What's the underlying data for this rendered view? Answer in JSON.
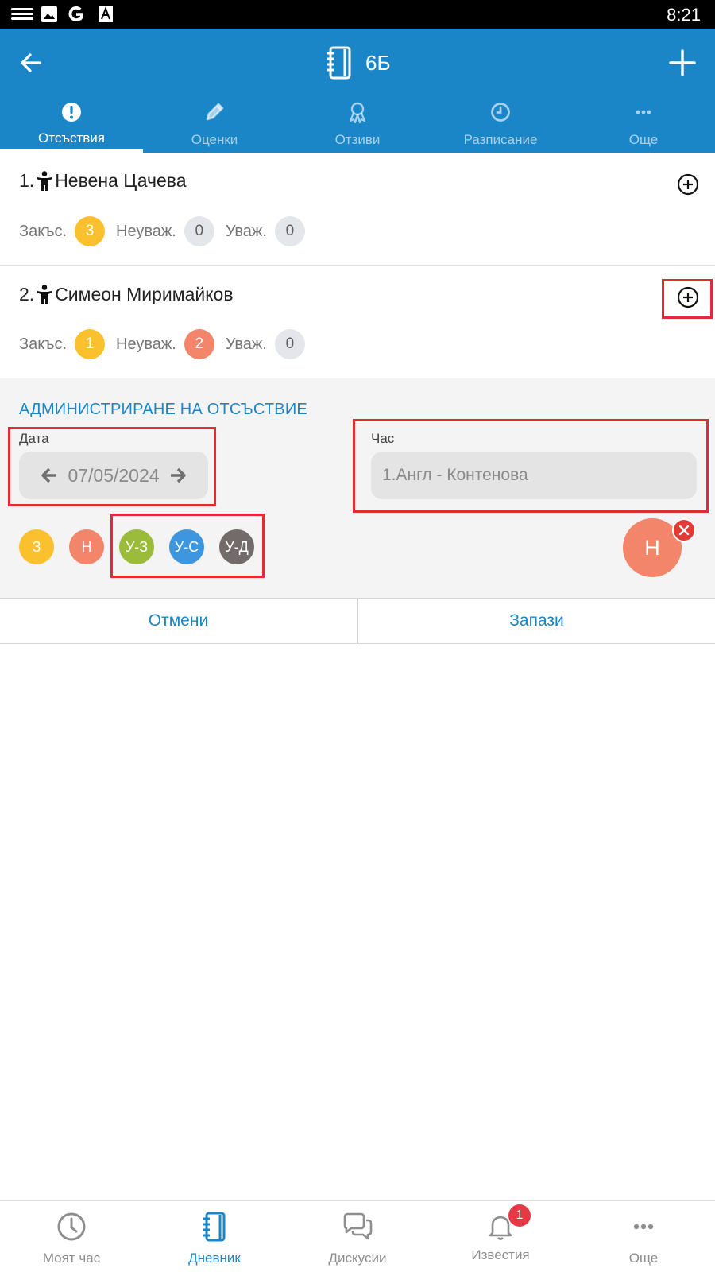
{
  "status_bar": {
    "time": "8:21",
    "icons": [
      "menu-lines-icon",
      "image-icon",
      "google-icon",
      "font-icon"
    ]
  },
  "app_bar": {
    "title": "6Б",
    "back_icon": "arrow-left-icon",
    "title_icon": "notebook-icon",
    "add_icon": "plus-icon",
    "color": "#1a86c8"
  },
  "tabs": [
    {
      "label": "Отсъствия",
      "icon": "exclamation-circle-icon",
      "active": true
    },
    {
      "label": "Оценки",
      "icon": "pencil-icon",
      "active": false
    },
    {
      "label": "Отзиви",
      "icon": "award-icon",
      "active": false
    },
    {
      "label": "Разписание",
      "icon": "clock-icon",
      "active": false
    },
    {
      "label": "Още",
      "icon": "more-dots-icon",
      "active": false
    }
  ],
  "students": [
    {
      "number": "1.",
      "name": "Невена  Цачева",
      "late_label": "Закъс.",
      "late": "3",
      "unexcused_label": "Неуваж.",
      "unexcused": "0",
      "excused_label": "Уваж.",
      "excused": "0"
    },
    {
      "number": "2.",
      "name": "Симеон  Миримайков",
      "late_label": "Закъс.",
      "late": "1",
      "unexcused_label": "Неуваж.",
      "unexcused": "2",
      "excused_label": "Уваж.",
      "excused": "0"
    }
  ],
  "admin": {
    "title": "АДМИНИСТРИРАНЕ НА ОТСЪСТВИЕ",
    "date_label": "Дата",
    "date_value": "07/05/2024",
    "hour_label": "Час",
    "hour_value": "1.Англ - Контенова",
    "types": [
      {
        "label": "З",
        "color": "#fbc02d"
      },
      {
        "label": "Н",
        "color": "#f2856a"
      },
      {
        "label": "У-З",
        "color": "#9bbb3b"
      },
      {
        "label": "У-С",
        "color": "#3d96de"
      },
      {
        "label": "У-Д",
        "color": "#736b69"
      }
    ],
    "selected": {
      "label": "Н",
      "color": "#f2856a"
    }
  },
  "actions": {
    "cancel": "Отмени",
    "save": "Запази"
  },
  "bottom_nav": [
    {
      "label": "Моят час",
      "icon": "clock-icon",
      "active": false
    },
    {
      "label": "Дневник",
      "icon": "notebook-icon",
      "active": true
    },
    {
      "label": "Дискусии",
      "icon": "chat-bubbles-icon",
      "active": false
    },
    {
      "label": "Известия",
      "icon": "bell-icon",
      "active": false,
      "badge": "1"
    },
    {
      "label": "Още",
      "icon": "more-dots-icon",
      "active": false
    }
  ]
}
